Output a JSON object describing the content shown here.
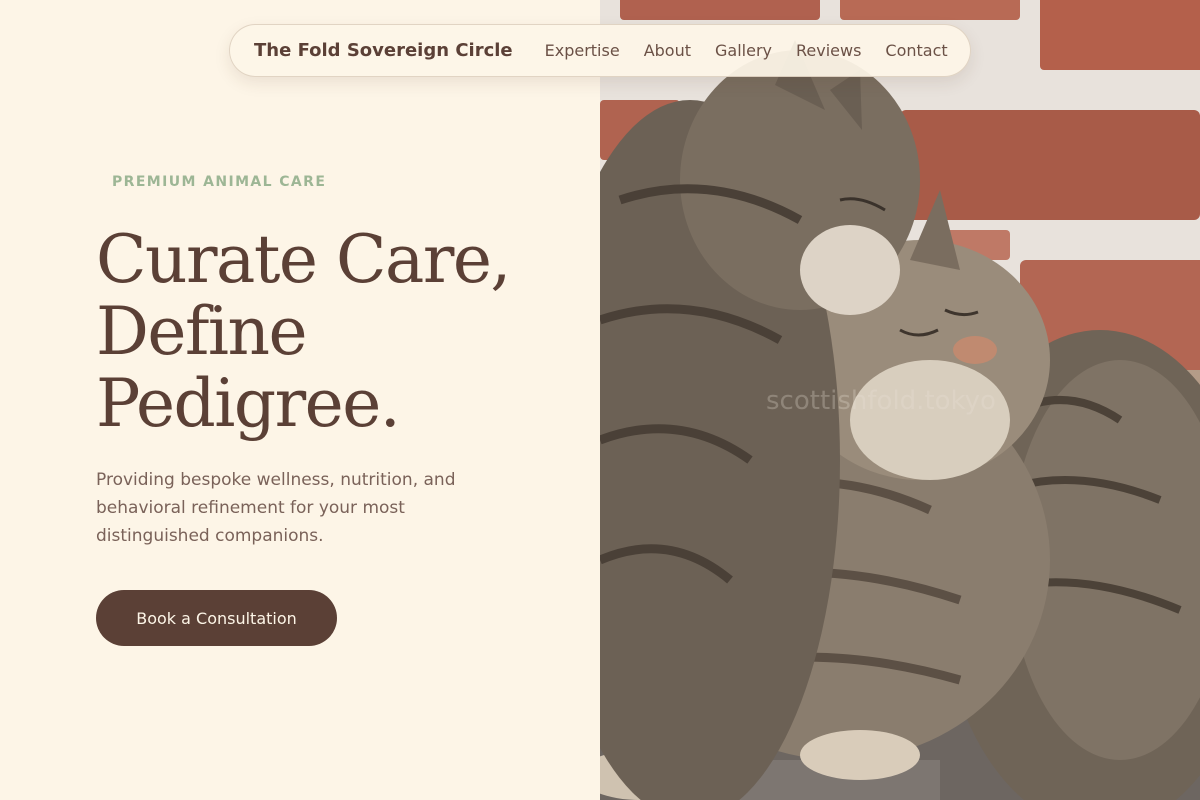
{
  "nav": {
    "brand": "The Fold Sovereign Circle",
    "links": [
      "Expertise",
      "About",
      "Gallery",
      "Reviews",
      "Contact"
    ]
  },
  "hero": {
    "eyebrow": "PREMIUM ANIMAL CARE",
    "headline_lines": [
      "Curate Care,",
      "Define",
      "Pedigree."
    ],
    "subtext": "Providing bespoke wellness, nutrition, and behavioral refinement for your most distinguished companions.",
    "cta_label": "Book a Consultation"
  },
  "image": {
    "watermark": "scottishfold.tokyo"
  },
  "colors": {
    "background": "#fdf5e7",
    "primary": "#5b4036",
    "accent": "#9db695",
    "muted_text": "#7a6259"
  }
}
